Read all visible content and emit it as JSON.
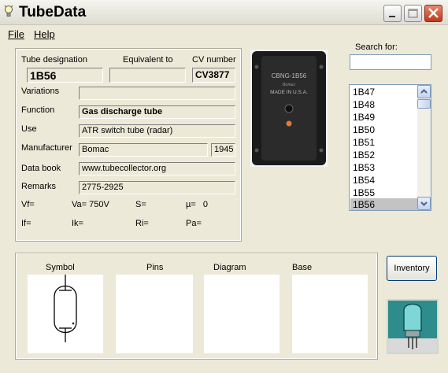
{
  "window": {
    "title": "TubeData"
  },
  "menu": {
    "file": "File",
    "help": "Help"
  },
  "details": {
    "tube_designation_label": "Tube designation",
    "tube_designation": "1B56",
    "equivalent_label": "Equivalent to",
    "equivalent": "",
    "cv_label": "CV number",
    "cv": "CV3877",
    "variations_label": "Variations",
    "variations": "",
    "function_label": "Function",
    "function": "Gas discharge tube",
    "use_label": "Use",
    "use": "ATR switch tube (radar)",
    "manufacturer_label": "Manufacturer",
    "manufacturer": "Bomac",
    "year": "1945",
    "databook_label": "Data book",
    "databook": "www.tubecollector.org",
    "remarks_label": "Remarks",
    "remarks": "2775-2925",
    "params": {
      "vf": "Vf=",
      "va": "Va= 750V",
      "s": "S=",
      "mu": "µ=   0",
      "if": "If=",
      "ik": "Ik=",
      "ri": "Ri=",
      "pa": "Pa="
    }
  },
  "photo": {
    "line1": "CBNG-1B56",
    "line2": "Bomac",
    "line3": "MADE IN U.S.A."
  },
  "search": {
    "label": "Search for:",
    "value": ""
  },
  "tube_list": {
    "items": [
      "1B47",
      "1B48",
      "1B49",
      "1B50",
      "1B51",
      "1B52",
      "1B53",
      "1B54",
      "1B55",
      "1B56"
    ],
    "selected": "1B56"
  },
  "bottom": {
    "symbol_label": "Symbol",
    "pins_label": "Pins",
    "diagram_label": "Diagram",
    "base_label": "Base"
  },
  "buttons": {
    "inventory": "Inventory"
  }
}
